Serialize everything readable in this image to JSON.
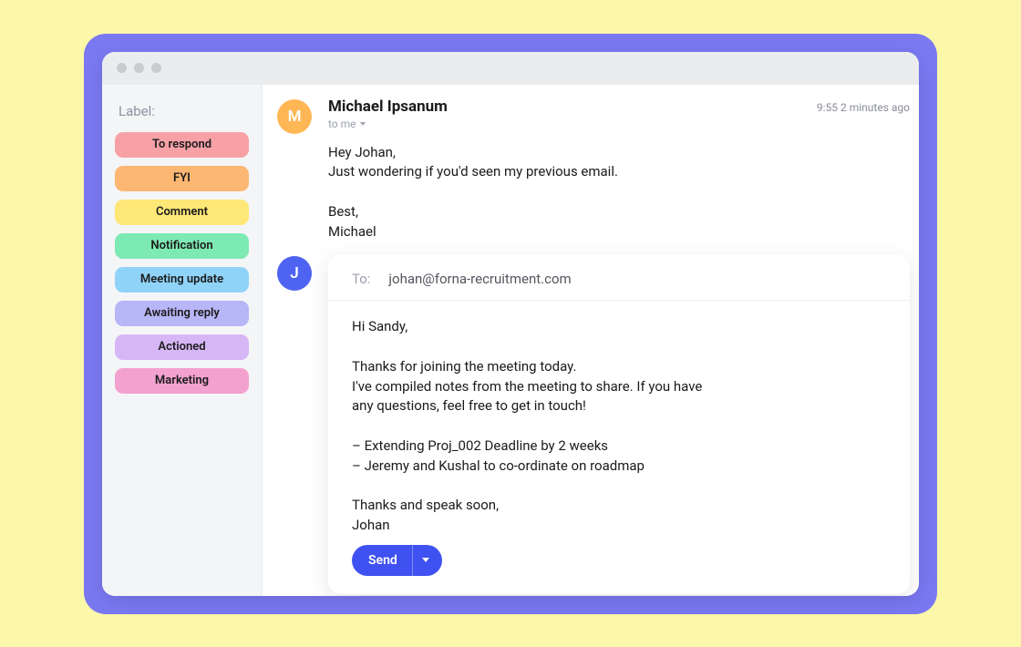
{
  "sidebar": {
    "heading": "Label:",
    "items": [
      {
        "label": "To respond",
        "color": "#f7a1a7"
      },
      {
        "label": "FYI",
        "color": "#fcb773"
      },
      {
        "label": "Comment",
        "color": "#fde777"
      },
      {
        "label": "Notification",
        "color": "#7de9b3"
      },
      {
        "label": "Meeting update",
        "color": "#8fd3f8"
      },
      {
        "label": "Awaiting reply",
        "color": "#b7b6f7"
      },
      {
        "label": "Actioned",
        "color": "#d7b6f6"
      },
      {
        "label": "Marketing",
        "color": "#f3a1cf"
      }
    ]
  },
  "thread": {
    "sender": {
      "name": "Michael Ipsanum",
      "initial": "M",
      "avatar_color": "#ffb756"
    },
    "recipient_line": "to me",
    "timestamp": "9:55 2 minutes ago",
    "body": "Hey Johan,\nJust wondering if you'd seen my previous email.\n\nBest,\nMichael"
  },
  "compose": {
    "author": {
      "initial": "J",
      "avatar_color": "#4f63f2"
    },
    "to_label": "To:",
    "to_value": "johan@forna-recruitment.com",
    "body": "Hi Sandy,\n\nThanks for joining the meeting today.\nI've compiled notes from the meeting to share. If you have\nany questions, feel free to get in touch!\n\n– Extending Proj_002 Deadline by 2 weeks\n– Jeremy and Kushal to co-ordinate on roadmap\n\nThanks and speak soon,\nJohan",
    "send_label": "Send"
  }
}
